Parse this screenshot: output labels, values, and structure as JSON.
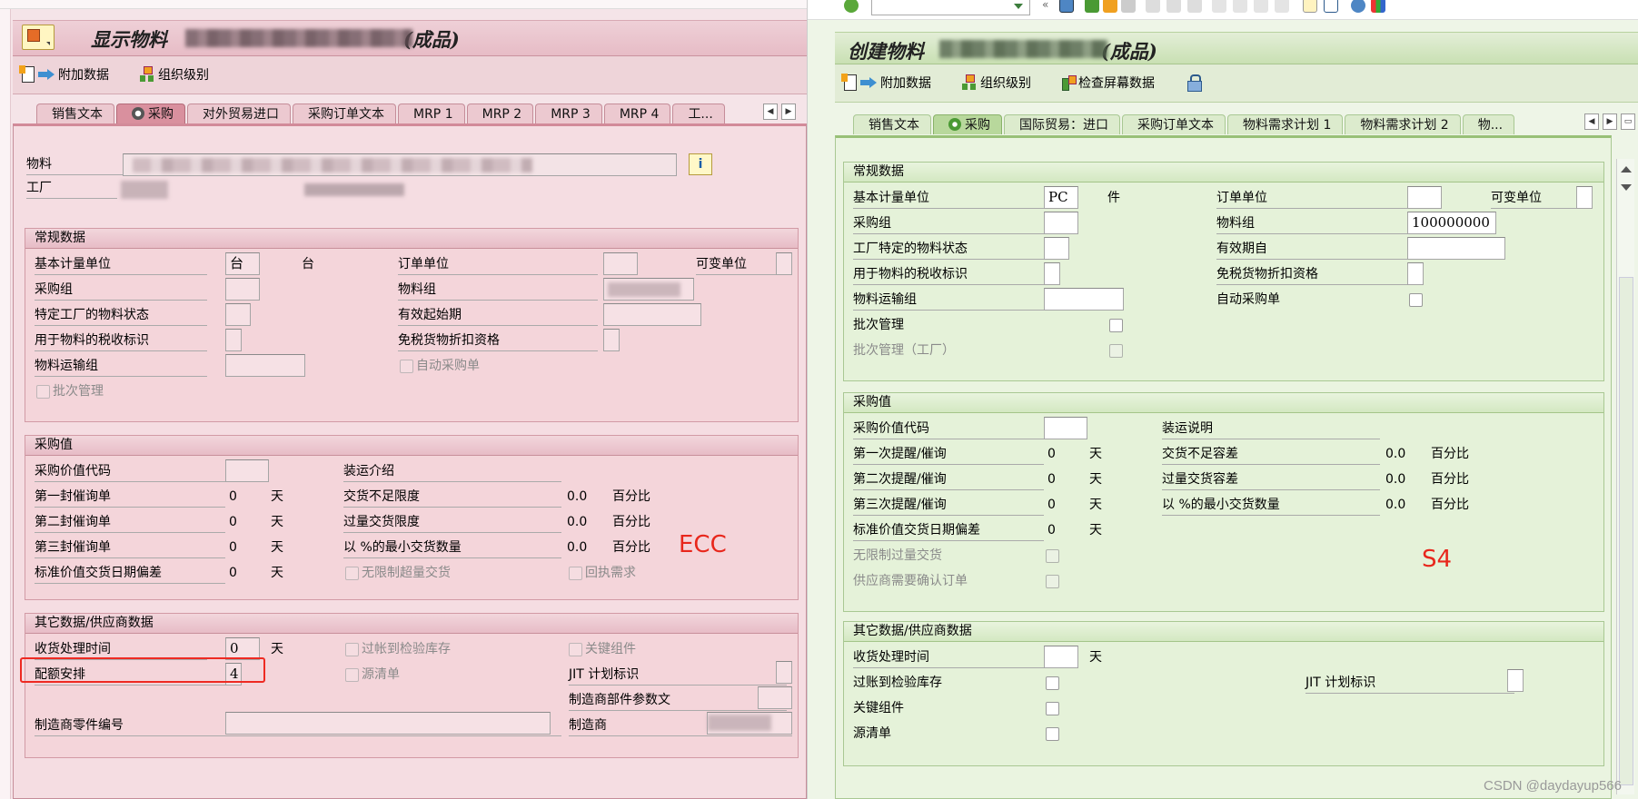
{
  "ecc": {
    "title_prefix": "显示物料",
    "title_suffix": "(成品)",
    "toolbar": {
      "additional_data": "附加数据",
      "org_levels": "组织级别"
    },
    "tabs": [
      {
        "label": "销售文本",
        "active": false
      },
      {
        "label": "采购",
        "active": true
      },
      {
        "label": "对外贸易进口",
        "active": false
      },
      {
        "label": "采购订单文本",
        "active": false
      },
      {
        "label": "MRP 1",
        "active": false
      },
      {
        "label": "MRP 2",
        "active": false
      },
      {
        "label": "MRP 3",
        "active": false
      },
      {
        "label": "MRP 4",
        "active": false
      },
      {
        "label": "工...",
        "active": false
      }
    ],
    "header": {
      "material_label": "物料",
      "plant_label": "工厂"
    },
    "general": {
      "title": "常规数据",
      "base_uom_label": "基本计量单位",
      "base_uom_value": "台",
      "base_uom_text": "台",
      "order_unit_label": "订单单位",
      "var_unit_label": "可变单位",
      "purch_group_label": "采购组",
      "material_group_label": "物料组",
      "plant_status_label": "特定工厂的物料状态",
      "valid_from_label": "有效起始期",
      "tax_ind_label": "用于物料的税收标识",
      "qual_discount_label": "免税货物折扣资格",
      "transport_group_label": "物料运输组",
      "auto_po_label": "自动采购单",
      "batch_mgmt_label": "批次管理"
    },
    "purch_values": {
      "title": "采购值",
      "value_key_label": "采购价值代码",
      "shipping_label": "装运介绍",
      "reminder1_label": "第一封催询单",
      "reminder1_value": "0",
      "reminder1_unit": "天",
      "reminder2_label": "第二封催询单",
      "reminder2_value": "0",
      "reminder2_unit": "天",
      "reminder3_label": "第三封催询单",
      "reminder3_value": "0",
      "reminder3_unit": "天",
      "std_dev_label": "标准价值交货日期偏差",
      "std_dev_value": "0",
      "std_dev_unit": "天",
      "under_tol_label": "交货不足限度",
      "under_tol_value": "0.0",
      "under_tol_unit": "百分比",
      "over_tol_label": "过量交货限度",
      "over_tol_value": "0.0",
      "over_tol_unit": "百分比",
      "min_qty_label": "以 %的最小交货数量",
      "min_qty_value": "0.0",
      "min_qty_unit": "百分比",
      "unlimited_label": "无限制超量交货",
      "ack_label": "回执需求"
    },
    "other": {
      "title": "其它数据/供应商数据",
      "gr_time_label": "收货处理时间",
      "gr_time_value": "0",
      "gr_time_unit": "天",
      "post_insp_label": "过帐到检验库存",
      "critical_label": "关键组件",
      "quota_label": "配额安排",
      "quota_value": "4",
      "source_list_label": "源清单",
      "jit_label": "JIT 计划标识",
      "mfr_part_profile_label": "制造商部件参数文",
      "mfr_part_no_label": "制造商零件编号",
      "manufacturer_label": "制造商"
    },
    "annotation": "ECC"
  },
  "s4": {
    "title_prefix": "创建物料",
    "title_suffix": "(成品)",
    "toolbar": {
      "additional_data": "附加数据",
      "org_levels": "组织级别",
      "check_screen": "检查屏幕数据"
    },
    "tabs": [
      {
        "label": "销售文本",
        "active": false
      },
      {
        "label": "采购",
        "active": true
      },
      {
        "label": "国际贸易：进口",
        "active": false
      },
      {
        "label": "采购订单文本",
        "active": false
      },
      {
        "label": "物料需求计划 1",
        "active": false
      },
      {
        "label": "物料需求计划 2",
        "active": false
      },
      {
        "label": "物...",
        "active": false
      }
    ],
    "general": {
      "title": "常规数据",
      "base_uom_label": "基本计量单位",
      "base_uom_value": "PC",
      "base_uom_text": "件",
      "order_unit_label": "订单单位",
      "var_unit_label": "可变单位",
      "purch_group_label": "采购组",
      "material_group_label": "物料组",
      "material_group_value": "100000000",
      "plant_status_label": "工厂特定的物料状态",
      "valid_from_label": "有效期自",
      "tax_ind_label": "用于物料的税收标识",
      "qual_discount_label": "免税货物折扣资格",
      "transport_group_label": "物料运输组",
      "auto_po_label": "自动采购单",
      "batch_mgmt_label": "批次管理",
      "batch_mgmt_plant_label": "批次管理（工厂）"
    },
    "purch_values": {
      "title": "采购值",
      "value_key_label": "采购价值代码",
      "shipping_label": "装运说明",
      "reminder1_label": "第一次提醒/催询",
      "reminder1_value": "0",
      "reminder1_unit": "天",
      "reminder2_label": "第二次提醒/催询",
      "reminder2_value": "0",
      "reminder2_unit": "天",
      "reminder3_label": "第三次提醒/催询",
      "reminder3_value": "0",
      "reminder3_unit": "天",
      "std_dev_label": "标准价值交货日期偏差",
      "std_dev_value": "0",
      "std_dev_unit": "天",
      "under_tol_label": "交货不足容差",
      "under_tol_value": "0.0",
      "under_tol_unit": "百分比",
      "over_tol_label": "过量交货容差",
      "over_tol_value": "0.0",
      "over_tol_unit": "百分比",
      "min_qty_label": "以 %的最小交货数量",
      "min_qty_value": "0.0",
      "min_qty_unit": "百分比",
      "unlimited_label": "无限制过量交货",
      "vendor_confirm_label": "供应商需要确认订单"
    },
    "other": {
      "title": "其它数据/供应商数据",
      "gr_time_label": "收货处理时间",
      "gr_time_unit": "天",
      "post_insp_label": "过账到检验库存",
      "critical_label": "关键组件",
      "source_list_label": "源清单",
      "jit_label": "JIT 计划标识"
    },
    "annotation": "S4"
  },
  "watermark": "CSDN @daydayup566"
}
